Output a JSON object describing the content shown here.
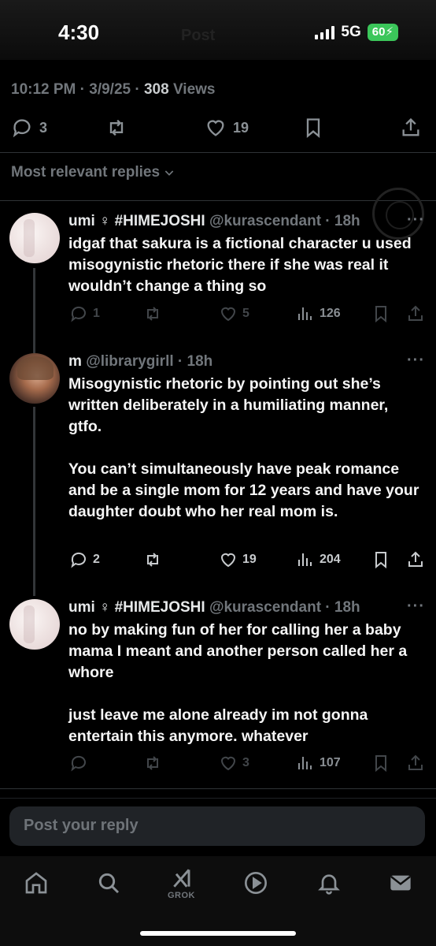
{
  "status": {
    "time": "4:30",
    "faint_title": "Post",
    "network": "5G",
    "battery": "60"
  },
  "post_meta": {
    "time": "10:12 PM",
    "date": "3/9/25",
    "views_count": "308",
    "views_label": "Views"
  },
  "post_actions": {
    "replies": "3",
    "likes": "19"
  },
  "sort": {
    "label": "Most relevant replies"
  },
  "replies": [
    {
      "name": "umi ♀ #HIMEJOSHI",
      "handle": "@kurascendant",
      "time": "18h",
      "text": [
        "idgaf that sakura is a fictional character u used misogynistic rhetoric there if she was real it wouldn’t change a thing so"
      ],
      "replies": "1",
      "likes": "5",
      "views": "126"
    },
    {
      "name": "m",
      "handle": "@librarygirll",
      "time": "18h",
      "text": [
        "Misogynistic rhetoric by pointing out she’s written deliberately in a humiliating manner, gtfo.",
        "You can’t simultaneously have peak romance and be a single mom for 12 years and have your daughter doubt who her real mom is."
      ],
      "replies": "2",
      "likes": "19",
      "views": "204"
    },
    {
      "name": "umi ♀ #HIMEJOSHI",
      "handle": "@kurascendant",
      "time": "18h",
      "text": [
        "no by making fun of her for calling her a baby mama I meant and another person called her a whore",
        "just leave me alone already im not gonna entertain this anymore. whatever"
      ],
      "replies": "",
      "likes": "3",
      "views": "107"
    }
  ],
  "composer": {
    "placeholder": "Post your reply"
  },
  "tabbar": {
    "grok_label": "GROK"
  },
  "colors": {
    "background": "#000000",
    "muted": "#71767b",
    "text": "#e7e9ea",
    "battery": "#3bc65a"
  }
}
